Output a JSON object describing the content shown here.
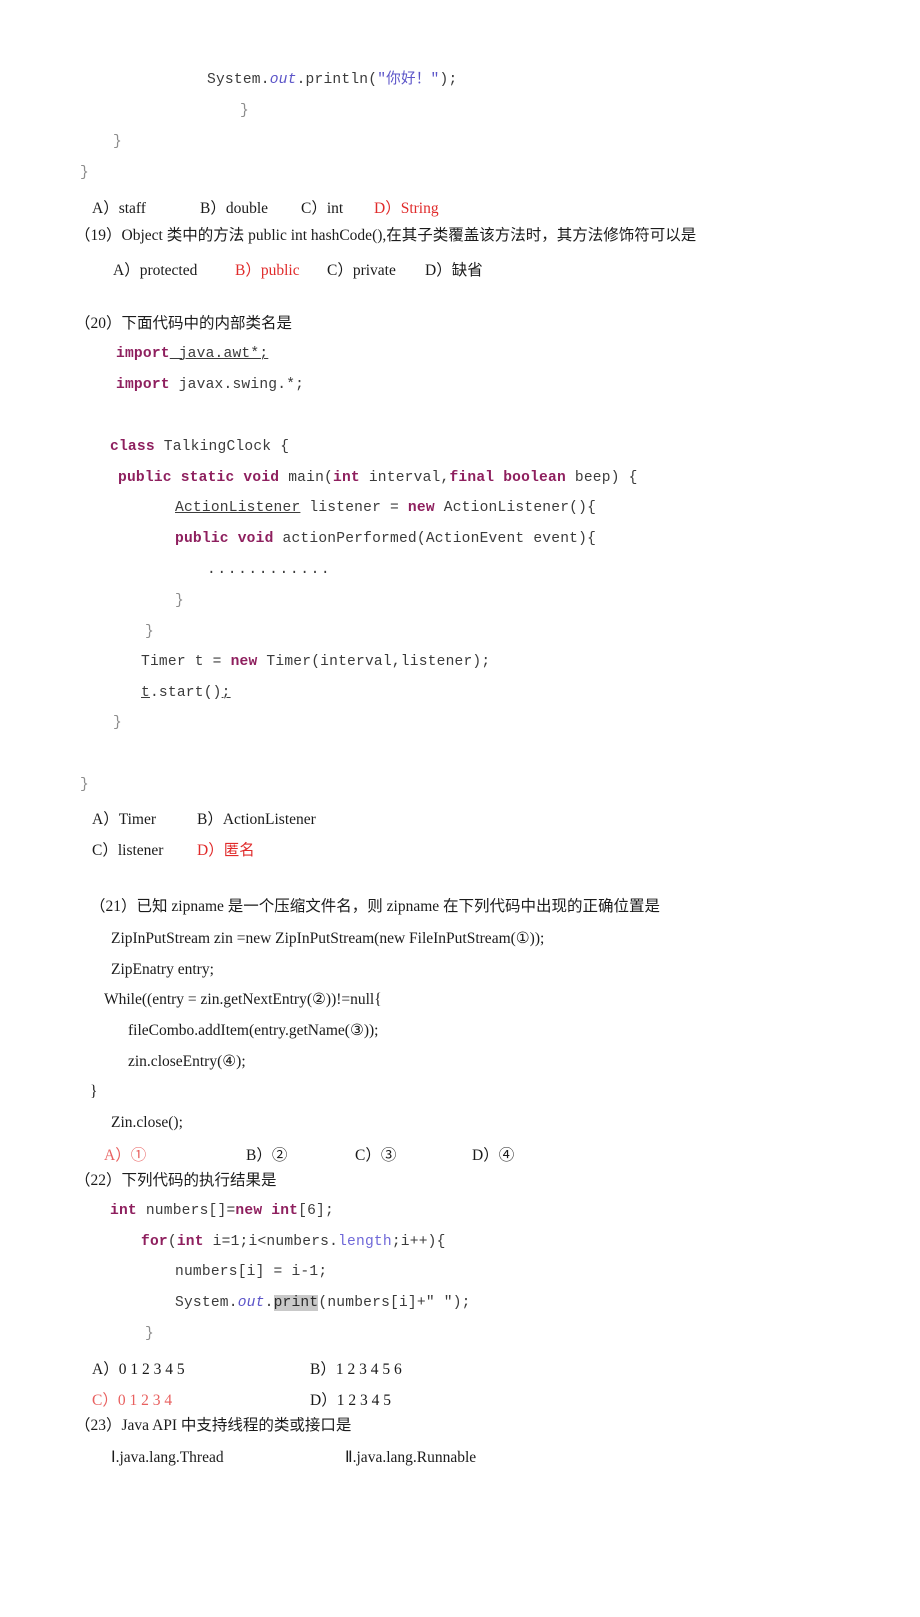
{
  "document": {
    "type": "exam-paper",
    "language": "zh-CN",
    "subject": "Java",
    "answer_color": "#e02b2b",
    "keyword_color": "#8e1f5e",
    "literal_color": "#5b54c8",
    "highlight_color": "#c9c9c9"
  },
  "code_top": {
    "line1_a": "System.",
    "line1_b": "out",
    "line1_c": ".println(",
    "line1_d": "\"你好！\"",
    "line1_e": ");",
    "line2": "}",
    "line3": "}",
    "line4": "}"
  },
  "q18_options": {
    "a_label": "A）staff",
    "b_label": "B）double",
    "c_label": "C）int",
    "d_label": "D）String",
    "correct": "D"
  },
  "q19": {
    "number": "（19）",
    "stem": "Object 类中的方法 public int hashCode(),在其子类覆盖该方法时，其方法修饰符可以是",
    "a_label": "A）protected",
    "b_label": "B）public",
    "c_label": "C）private",
    "d_label": "D）缺省",
    "correct": "B"
  },
  "q20": {
    "number": "（20）",
    "stem": "下面代码中的内部类名是",
    "code": {
      "l1_kw": "import",
      "l1_rest": " java.awt*;",
      "l2_kw": "import",
      "l2_rest": " javax.swing.*;",
      "l3_kw": "class",
      "l3_rest": " TalkingClock {",
      "l4_kw1": "public static void",
      "l4_mid": " main(",
      "l4_kw2": "int",
      "l4_mid2": " interval,",
      "l4_kw3": "final boolean",
      "l4_end": " beep) {",
      "l5_type": "ActionListener",
      "l5_mid": " listener = ",
      "l5_kw": "new",
      "l5_end": " ActionListener(){",
      "l6_kw": "public void",
      "l6_end": " actionPerformed(ActionEvent event){",
      "l7": "............",
      "l8": "}",
      "l9": "}",
      "l10_a": "Timer t = ",
      "l10_kw": "new",
      "l10_b": " Timer(interval,listener);",
      "l11_a": "t",
      "l11_b": ".start()",
      "l11_c": ";",
      "l12": "}",
      "l13": "}"
    },
    "a_label": "A）Timer",
    "b_label": "B）ActionListener",
    "c_label": "C）listener",
    "d_label": "D）匿名",
    "correct": "D"
  },
  "q21": {
    "number": "（21）",
    "stem": "已知 zipname 是一个压缩文件名，则 zipname 在下列代码中出现的正确位置是",
    "code": {
      "l1": "ZipInPutStream zin =new ZipInPutStream(new FileInPutStream(①));",
      "l2": "ZipEnatry entry;",
      "l3": "While((entry = zin.getNextEntry(②))!=null{",
      "l4": "fileCombo.addItem(entry.getName(③));",
      "l5": "zin.closeEntry(④);",
      "l6": "}",
      "l7": "Zin.close();"
    },
    "a_label": "A）①",
    "b_label": "B）②",
    "c_label": "C）③",
    "d_label": "D）④",
    "correct": "A"
  },
  "q22": {
    "number": "（22）",
    "stem": "下列代码的执行结果是",
    "code": {
      "l1_kw": "int",
      "l1_mid": " numbers[]=",
      "l1_kw2": "new int",
      "l1_end": "[6];",
      "l2_kw": "for",
      "l2_a": "(",
      "l2_kw2": "int",
      "l2_b": " i=1;i<numbers.",
      "l2_field": "length",
      "l2_c": ";i++){",
      "l3": "numbers[i] = i-1;",
      "l4_a": "System.",
      "l4_ital": "out",
      "l4_b": ".",
      "l4_hl": "print",
      "l4_c": "(numbers[i]+\" \");",
      "l5": "}"
    },
    "a_label": "A）0 1 2 3 4 5",
    "b_label": "B）1 2 3 4 5 6",
    "c_label": "C）0 1 2 3 4",
    "d_label": "D）1 2 3 4 5",
    "correct": "C"
  },
  "q23": {
    "number": "（23）",
    "stem": "Java API 中支持线程的类或接口是",
    "item_1": "Ⅰ.java.lang.Thread",
    "item_2": "Ⅱ.java.lang.Runnable"
  }
}
